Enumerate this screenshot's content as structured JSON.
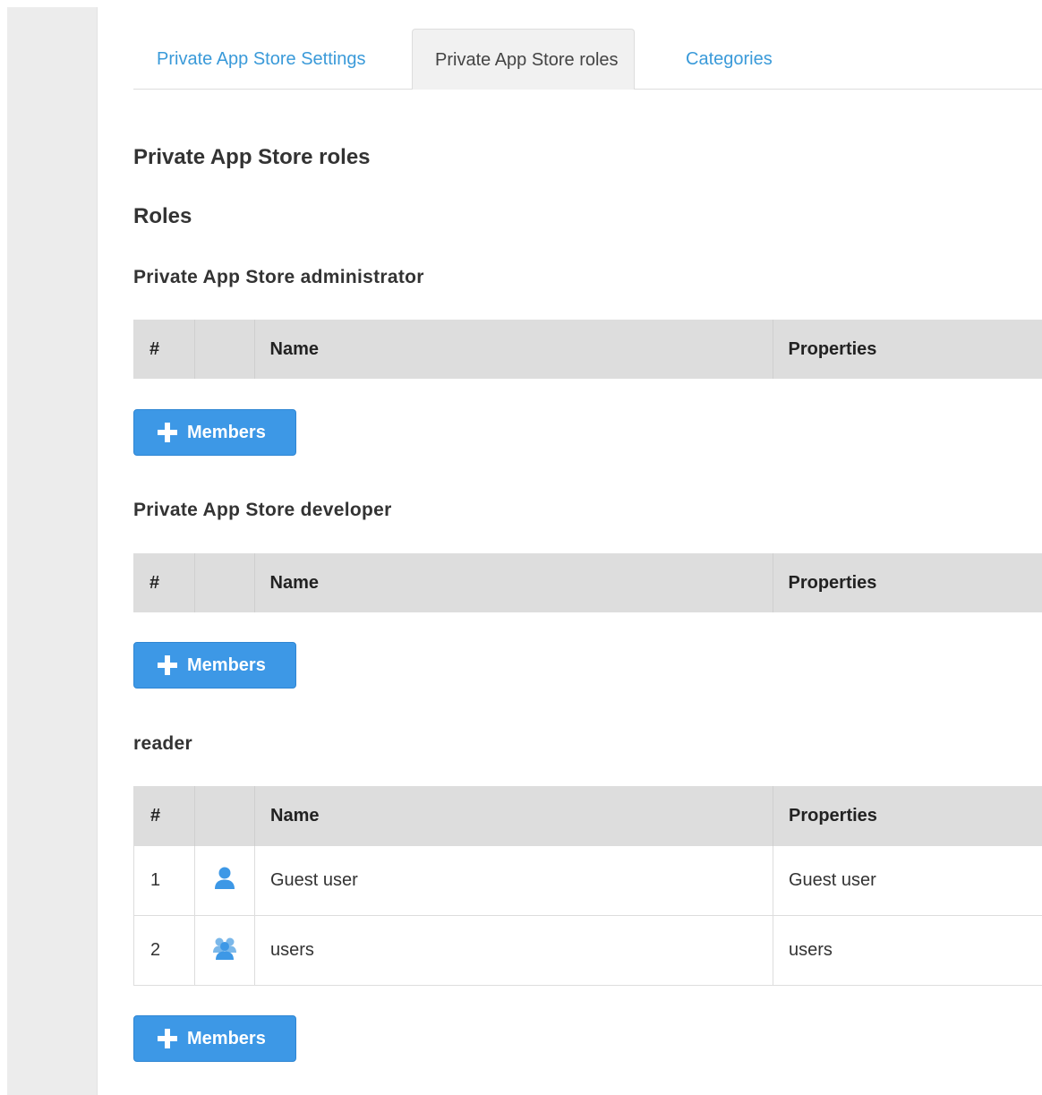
{
  "tabs": [
    {
      "label": "Private App Store Settings"
    },
    {
      "label": "Private App Store roles"
    },
    {
      "label": "Categories"
    }
  ],
  "page_title": "Private App Store roles",
  "section_title": "Roles",
  "table_headers": {
    "num": "#",
    "icon": "",
    "name": "Name",
    "properties": "Properties"
  },
  "roles": [
    {
      "title": "Private App Store administrator",
      "button_label": "Members",
      "members": []
    },
    {
      "title": "Private App Store developer",
      "button_label": "Members",
      "members": []
    },
    {
      "title": "reader",
      "button_label": "Members",
      "members": [
        {
          "num": "1",
          "icon": "user-icon",
          "name": "Guest user",
          "properties": "Guest user"
        },
        {
          "num": "2",
          "icon": "group-icon",
          "name": "users",
          "properties": "users"
        }
      ]
    }
  ],
  "colors": {
    "accent": "#3d98e6",
    "link": "#3a9ad9",
    "header_bg": "#dddddd",
    "icon": "#3d98e6"
  }
}
